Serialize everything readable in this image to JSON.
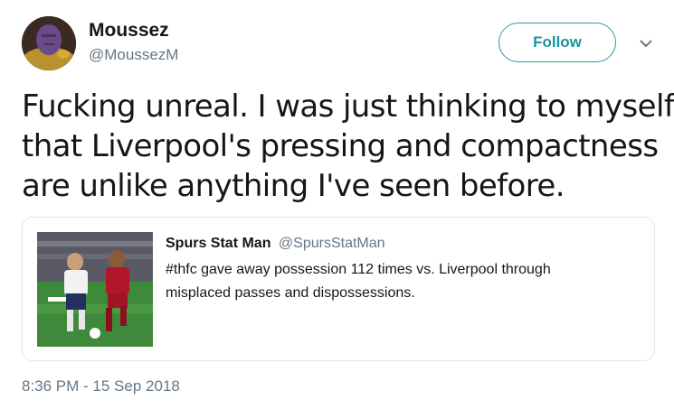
{
  "author": {
    "name": "Moussez",
    "handle": "@MoussezM"
  },
  "follow_label": "Follow",
  "tweet": {
    "lines": [
      "Fucking unreal. I was just thinking to myself",
      "that Liverpool's pressing and compactness",
      "are unlike anything I've seen before."
    ]
  },
  "quoted_tweet": {
    "name": "Spurs Stat Man",
    "handle": "@SpursStatMan",
    "lines": [
      "#thfc gave away possession 112 times vs. Liverpool through",
      "misplaced passes and dispossessions."
    ]
  },
  "timestamp": "8:36 PM - 15 Sep 2018",
  "icons": {
    "menu": "chevron-down-icon"
  },
  "colors": {
    "follow_accent": "#1da1a8",
    "secondary_text": "#657786",
    "border": "#e1e8ed"
  }
}
